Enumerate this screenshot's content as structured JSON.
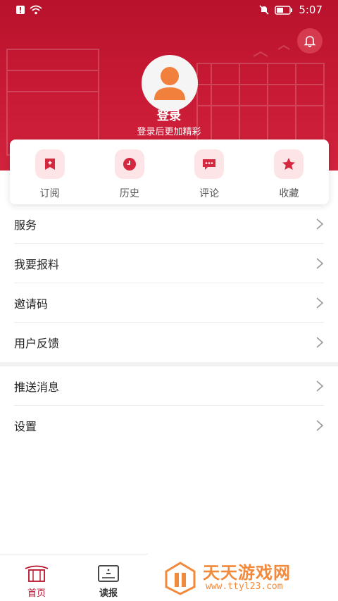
{
  "status_bar": {
    "time": "5:07",
    "icons": [
      "alert-icon",
      "wifi-icon",
      "mute-icon",
      "battery-icon"
    ]
  },
  "header": {
    "login_title": "登录",
    "login_subtitle": "登录后更加精彩",
    "accent_color": "#c91a35"
  },
  "quick_actions": [
    {
      "label": "订阅",
      "icon": "subscribe-icon"
    },
    {
      "label": "历史",
      "icon": "history-icon"
    },
    {
      "label": "评论",
      "icon": "comment-icon"
    },
    {
      "label": "收藏",
      "icon": "favorite-icon"
    }
  ],
  "menu_group_1": [
    {
      "label": "服务"
    },
    {
      "label": "我要报料"
    },
    {
      "label": "邀请码"
    },
    {
      "label": "用户反馈"
    }
  ],
  "menu_group_2": [
    {
      "label": "推送消息"
    },
    {
      "label": "设置"
    }
  ],
  "bottom_nav": [
    {
      "label": "首页",
      "icon": "home-icon"
    },
    {
      "label": "读报",
      "icon": "newspaper-icon"
    }
  ],
  "watermark": {
    "title": "天天游戏网",
    "url": "www.ttyl23.com"
  }
}
